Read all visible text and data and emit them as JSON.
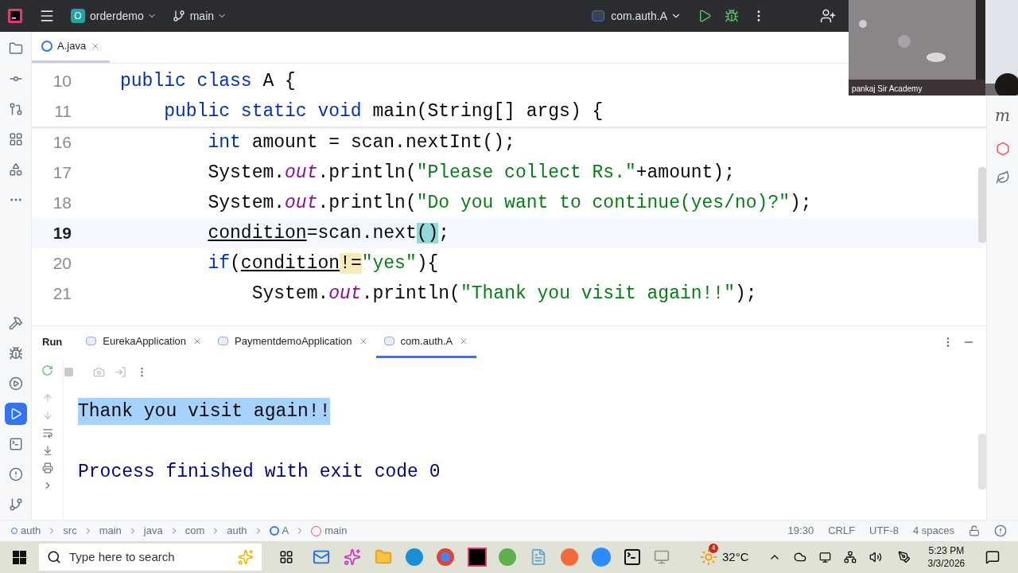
{
  "topbar": {
    "project_badge": "O",
    "project": "orderdemo",
    "branch": "main",
    "run_config": "com.auth.A"
  },
  "video_tile": {
    "kind": "picture",
    "name": "pankaj Sir Academy"
  },
  "editor": {
    "tabs": [
      {
        "label": "A.java",
        "selected": true
      }
    ],
    "sticky_lines": [
      {
        "number": "10",
        "current": false,
        "tokens": [
          {
            "kind": "keyword",
            "text": "public class"
          },
          {
            "kind": "plain",
            "text": " A {"
          }
        ]
      },
      {
        "number": "11",
        "current": false,
        "tokens": [
          {
            "kind": "keyword",
            "text": "    public static void"
          },
          {
            "kind": "plain",
            "text": " main(String[] args) {"
          }
        ]
      }
    ],
    "lines": [
      {
        "number": "16",
        "current": false,
        "tokens": [
          {
            "kind": "keyword",
            "text": "        int"
          },
          {
            "kind": "plain",
            "text": " amount = scan.nextInt();"
          }
        ]
      },
      {
        "number": "17",
        "current": false,
        "tokens": [
          {
            "kind": "plain",
            "text": "        System."
          },
          {
            "kind": "field",
            "text": "out"
          },
          {
            "kind": "plain",
            "text": ".println("
          },
          {
            "kind": "string",
            "text": "\"Please collect Rs.\""
          },
          {
            "kind": "plain",
            "text": "+amount);"
          }
        ]
      },
      {
        "number": "18",
        "current": false,
        "tokens": [
          {
            "kind": "plain",
            "text": "        System."
          },
          {
            "kind": "field",
            "text": "out"
          },
          {
            "kind": "plain",
            "text": ".println("
          },
          {
            "kind": "string",
            "text": "\"Do you want to continue(yes/no)?\""
          },
          {
            "kind": "plain",
            "text": ");"
          }
        ]
      },
      {
        "number": "19",
        "current": true,
        "tokens": [
          {
            "kind": "variable",
            "text": "        condition"
          },
          {
            "kind": "plain",
            "text": "=scan.next"
          },
          {
            "kind": "match",
            "text": "()"
          },
          {
            "kind": "plain",
            "text": ";"
          }
        ]
      },
      {
        "number": "20",
        "current": false,
        "tokens": [
          {
            "kind": "keyword",
            "text": "        if"
          },
          {
            "kind": "plain",
            "text": "("
          },
          {
            "kind": "variable",
            "text": "condition"
          },
          {
            "kind": "warning",
            "text": "!="
          },
          {
            "kind": "string",
            "text": "\"yes\""
          },
          {
            "kind": "plain",
            "text": "){"
          }
        ]
      },
      {
        "number": "21",
        "current": false,
        "tokens": [
          {
            "kind": "plain",
            "text": "            System."
          },
          {
            "kind": "field",
            "text": "out"
          },
          {
            "kind": "plain",
            "text": ".println("
          },
          {
            "kind": "string",
            "text": "\"Thank you visit again!!\""
          },
          {
            "kind": "plain",
            "text": ");"
          }
        ]
      }
    ]
  },
  "run_panel": {
    "title": "Run",
    "tabs": [
      {
        "label": "EurekaApplication",
        "selected": false
      },
      {
        "label": "PaymentdemoApplication",
        "selected": false
      },
      {
        "label": "com.auth.A",
        "selected": true
      }
    ],
    "output": [
      {
        "kind": "message",
        "text": "Thank you visit again!!",
        "selected": true
      },
      {
        "kind": "exit",
        "text": "Process finished with exit code 0",
        "selected": false
      }
    ]
  },
  "right_strip": {
    "plugin_label": "m"
  },
  "breadcrumbs": [
    {
      "kind": "module",
      "text": "auth"
    },
    {
      "kind": "folder",
      "text": "src"
    },
    {
      "kind": "folder",
      "text": "main"
    },
    {
      "kind": "folder",
      "text": "java"
    },
    {
      "kind": "folder",
      "text": "com"
    },
    {
      "kind": "folder",
      "text": "auth"
    },
    {
      "kind": "class",
      "text": "A"
    },
    {
      "kind": "method",
      "text": "main"
    }
  ],
  "status": [
    "19:30",
    "CRLF",
    "UTF-8",
    "4 spaces"
  ],
  "taskbar": {
    "search_placeholder": "Type here to search",
    "weather_badge": "4",
    "temperature": "32°C",
    "time": "5:23 PM",
    "date": "3/3/2026"
  }
}
